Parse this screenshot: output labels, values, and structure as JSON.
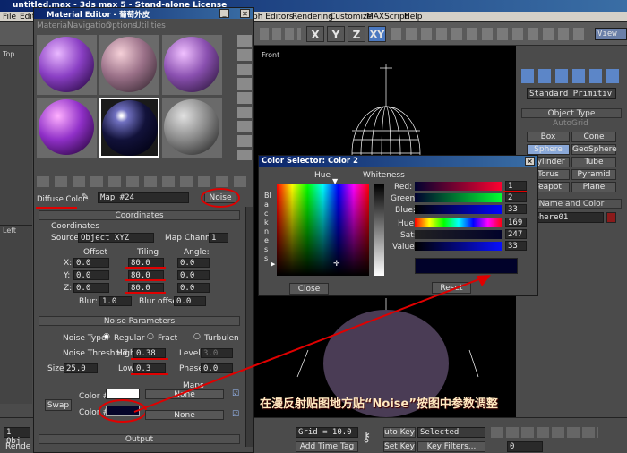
{
  "app": {
    "title": "untitled.max - 3ds max 5 - Stand-alone License"
  },
  "menubar": {
    "file": "File",
    "edit": "Edit",
    "graph_editors": "ph Editors",
    "rendering": "Rendering",
    "customize": "Customize",
    "maxscript": "MAXScript",
    "help": "Help"
  },
  "toolbar": {
    "x": "X",
    "y": "Y",
    "z": "Z",
    "xy": "XY",
    "view": "View"
  },
  "viewports": {
    "top": "Top",
    "left": "Left",
    "front": "Front"
  },
  "command_panel": {
    "dropdown": "Standard Primitiv",
    "object_type": "Object Type",
    "autogrid": "AutoGrid",
    "buttons": [
      "Box",
      "Cone",
      "Sphere",
      "GeoSphere",
      "Cylinder",
      "Tube",
      "Torus",
      "Pyramid",
      "Teapot",
      "Plane"
    ],
    "name_color": "Name and Color",
    "object_name": "Sphere01",
    "color": "#8b1a1a"
  },
  "status": {
    "objects": "1 Obj",
    "render": "Rende",
    "grid": "Grid = 10.0",
    "add_time_tag": "Add Time Tag",
    "auto_key": "uto Key",
    "set_key": "Set Key",
    "selected": "Selected",
    "key_filters": "Key Filters...",
    "frame": "0"
  },
  "material_editor": {
    "title": "Material Editor - 葡萄外皮",
    "menu": [
      "Material",
      "Navigation",
      "Options",
      "Utilities"
    ],
    "diffuse_label": "Diffuse Color:",
    "map_name": "Map #24",
    "map_type": "Noise",
    "coordinates": {
      "header": "Coordinates",
      "section": "Coordinates",
      "source_label": "Source:",
      "source_value": "Object XYZ",
      "map_channel_label": "Map Channel:",
      "map_channel_value": "1",
      "offset_label": "Offset",
      "tiling_label": "Tiling",
      "angle_label": "Angle:",
      "x": "X:",
      "y": "Y:",
      "z": "Z:",
      "offset": [
        "0.0",
        "0.0",
        "0.0"
      ],
      "tiling": [
        "80.0",
        "80.0",
        "80.0"
      ],
      "angle": [
        "0.0",
        "0.0",
        "0.0"
      ],
      "blur_label": "Blur:",
      "blur": "1.0",
      "blur_offset_label": "Blur offset:",
      "blur_offset": "0.0"
    },
    "noise": {
      "header": "Noise Parameters",
      "type_label": "Noise Type:",
      "regular": "Regular",
      "fractal": "Fract",
      "turbulence": "Turbulen",
      "threshold_label": "Noise Threshold:",
      "high_label": "High:",
      "high": "0.38",
      "levels_label": "Levels:",
      "levels": "3.0",
      "size_label": "Size:",
      "size": "25.0",
      "low_label": "Low:",
      "low": "0.3",
      "phase_label": "Phase:",
      "phase": "0.0",
      "maps_label": "Maps",
      "swap": "Swap",
      "color1_label": "Color #1",
      "color2_label": "Color #2",
      "color1": "#ffffff",
      "color2": "#05052a",
      "none1": "None",
      "none2": "None"
    },
    "output": "Output"
  },
  "color_selector": {
    "title": "Color Selector: Color 2",
    "hue_label": "Hue",
    "whiteness_label": "Whiteness",
    "blackness_label": "Blackness",
    "red_label": "Red:",
    "red": "1",
    "green_label": "Green:",
    "green": "2",
    "blue_label": "Blue:",
    "blue": "33",
    "hue_field_label": "Hue:",
    "hue": "169",
    "sat_label": "Sat:",
    "sat": "247",
    "value_label": "Value:",
    "value": "33",
    "close": "Close",
    "reset": "Reset",
    "swatch": "#01022a"
  },
  "annotation": {
    "text": "在漫反射贴图地方贴“Noise”按图中参数调整",
    "color": "#e00000"
  }
}
